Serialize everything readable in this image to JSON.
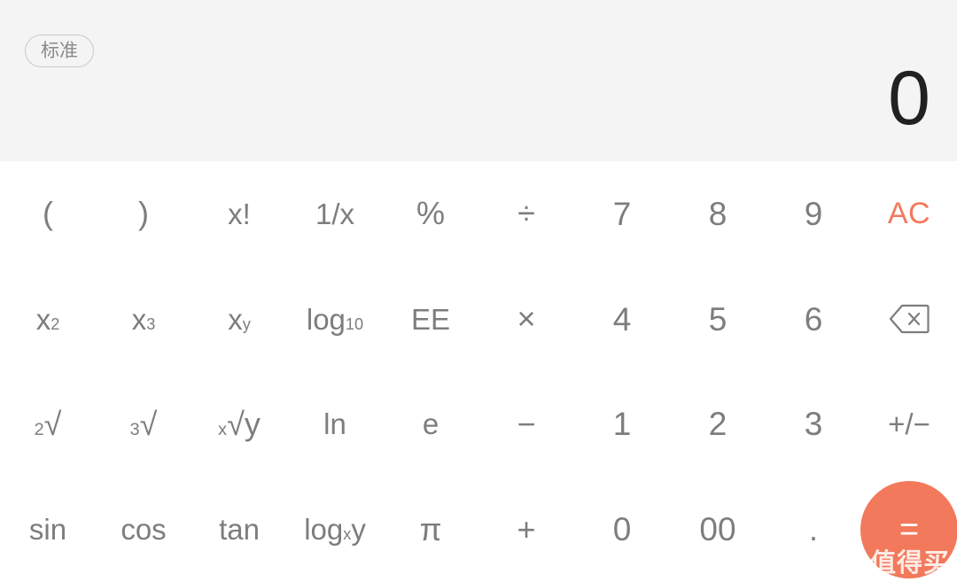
{
  "app": {
    "name": "Calculator",
    "background": "#ffffff",
    "header_background": "#f4f4f4",
    "accent_color": "#f2795b",
    "key_color": "#7d7d7d"
  },
  "header": {
    "mode_label": "标准",
    "display_value": "0"
  },
  "keypad": {
    "rows": [
      [
        {
          "id": "open-paren",
          "label": "(",
          "style": "sym"
        },
        {
          "id": "close-paren",
          "label": ")",
          "style": "sym"
        },
        {
          "id": "factorial",
          "label": "x!",
          "style": "small"
        },
        {
          "id": "reciprocal",
          "label": "1/x",
          "style": "small"
        },
        {
          "id": "percent",
          "label": "%",
          "style": "sym"
        },
        {
          "id": "divide",
          "label": "÷",
          "style": "sym"
        },
        {
          "id": "digit-7",
          "label": "7",
          "style": ""
        },
        {
          "id": "digit-8",
          "label": "8",
          "style": ""
        },
        {
          "id": "digit-9",
          "label": "9",
          "style": ""
        },
        {
          "id": "all-clear",
          "label": "AC",
          "style": "accent"
        }
      ],
      [
        {
          "id": "square",
          "label": "x",
          "sup": "2",
          "style": "small"
        },
        {
          "id": "cube",
          "label": "x",
          "sup": "3",
          "style": "small"
        },
        {
          "id": "power-y",
          "label": "x",
          "sup": "y",
          "style": "small"
        },
        {
          "id": "log-10",
          "label": "log",
          "sub": "10",
          "style": "small"
        },
        {
          "id": "exponent-ee",
          "label": "EE",
          "style": "small"
        },
        {
          "id": "multiply",
          "label": "×",
          "style": "sym"
        },
        {
          "id": "digit-4",
          "label": "4",
          "style": ""
        },
        {
          "id": "digit-5",
          "label": "5",
          "style": ""
        },
        {
          "id": "digit-6",
          "label": "6",
          "style": ""
        },
        {
          "id": "backspace",
          "label": "",
          "icon": "backspace-icon",
          "style": ""
        }
      ],
      [
        {
          "id": "square-root",
          "presup": "2",
          "label": "√",
          "style": "sym"
        },
        {
          "id": "cube-root",
          "presup": "3",
          "label": "√",
          "style": "sym"
        },
        {
          "id": "nth-root",
          "presup": "x",
          "label": "√y",
          "style": "sym"
        },
        {
          "id": "natural-log",
          "label": "ln",
          "style": "small"
        },
        {
          "id": "euler-e",
          "label": "e",
          "style": "small"
        },
        {
          "id": "subtract",
          "label": "−",
          "style": "sym"
        },
        {
          "id": "digit-1",
          "label": "1",
          "style": ""
        },
        {
          "id": "digit-2",
          "label": "2",
          "style": ""
        },
        {
          "id": "digit-3",
          "label": "3",
          "style": ""
        },
        {
          "id": "sign-toggle",
          "label": "+/−",
          "style": "small"
        }
      ],
      [
        {
          "id": "sine",
          "label": "sin",
          "style": "small"
        },
        {
          "id": "cosine",
          "label": "cos",
          "style": "small"
        },
        {
          "id": "tangent",
          "label": "tan",
          "style": "small"
        },
        {
          "id": "log-base-x",
          "label": "log",
          "sub": "x",
          "suffix": "y",
          "style": "small"
        },
        {
          "id": "pi",
          "label": "π",
          "style": "sym"
        },
        {
          "id": "add",
          "label": "+",
          "style": "sym"
        },
        {
          "id": "digit-0",
          "label": "0",
          "style": ""
        },
        {
          "id": "digit-00",
          "label": "00",
          "style": ""
        },
        {
          "id": "decimal",
          "label": ".",
          "style": "sym"
        },
        {
          "id": "equals",
          "label": "=",
          "style": "equals"
        }
      ]
    ]
  },
  "watermark": {
    "badge": "值",
    "text": "什么值得买"
  }
}
